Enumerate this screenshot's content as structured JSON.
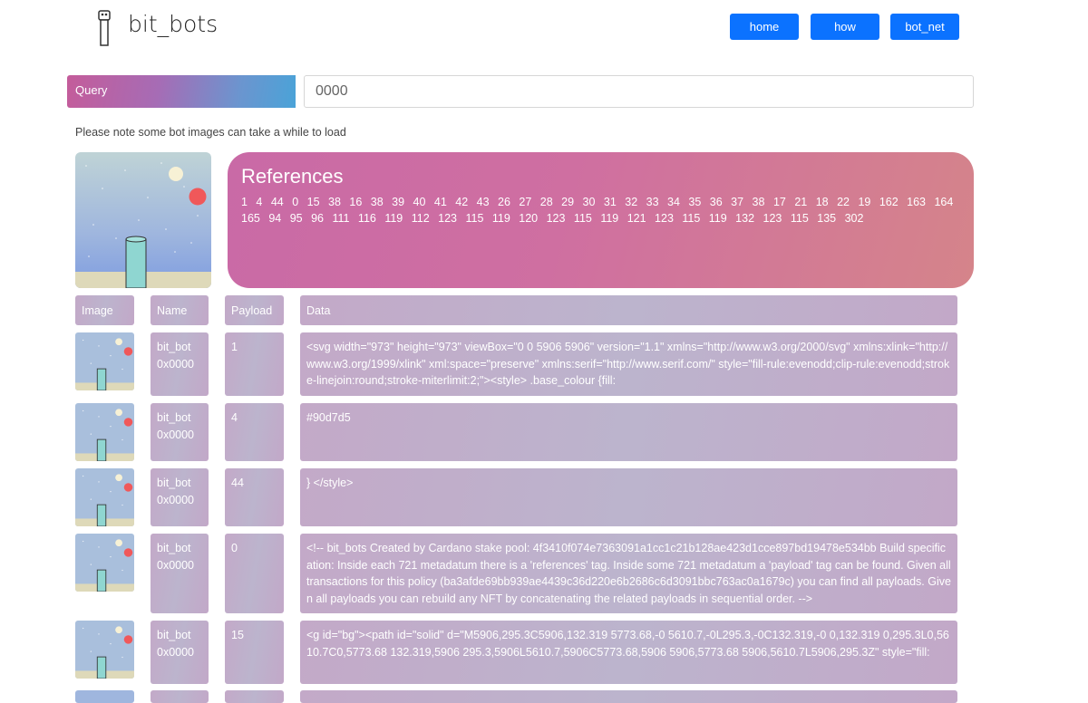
{
  "brand": "bit_bots",
  "nav": {
    "home": "home",
    "how": "how",
    "bot_net": "bot_net"
  },
  "query": {
    "label": "Query",
    "value": "0000"
  },
  "note": "Please note some bot images can take a while to load",
  "references": {
    "title": "References",
    "numbers": "1 4 44 0 15 38 16 38 39 40 41 42 43 26 27 28 29 30 31 32 33 34 35 36 37 38 17 21 18 22 19 162 163 164 165 94 95 96 111 116 119 112 123 115 119 120 123 115 119 121 123 115 119 132 123 115 135 302"
  },
  "table": {
    "headers": [
      "Image",
      "Name",
      "Payload",
      "Data"
    ],
    "rows": [
      {
        "name": "bit_bot 0x0000",
        "payload": "1",
        "data": "<svg width=\"973\" height=\"973\" viewBox=\"0 0 5906 5906\" version=\"1.1\" xmlns=\"http://www.w3.org/2000/svg\" xmlns:xlink=\"http://www.w3.org/1999/xlink\" xml:space=\"preserve\" xmlns:serif=\"http://www.serif.com/\" style=\"fill-rule:evenodd;clip-rule:evenodd;stroke-linejoin:round;stroke-miterlimit:2;\"><style> .base_colour {fill:"
      },
      {
        "name": "bit_bot 0x0000",
        "payload": "4",
        "data": "#90d7d5"
      },
      {
        "name": "bit_bot 0x0000",
        "payload": "44",
        "data": "} </style>"
      },
      {
        "name": "bit_bot 0x0000",
        "payload": "0",
        "data": "<!-- bit_bots Created by Cardano stake pool: 4f3410f074e7363091a1cc1c21b128ae423d1cce897bd19478e534bb Build specification: Inside each 721 metadatum there is a 'references' tag. Inside some 721 metadatum a 'payload' tag can be found. Given all transactions for this policy (ba3afde69bb939ae4439c36d220e6b2686c6d3091bbc763ac0a1679c) you can find all payloads. Given all payloads you can rebuild any NFT by concatenating the related payloads in sequential order. -->"
      },
      {
        "name": "bit_bot 0x0000",
        "payload": "15",
        "data": "<g id=\"bg\"><path id=\"solid\" d=\"M5906,295.3C5906,132.319 5773.68,-0 5610.7,-0L295.3,-0C132.319,-0 0,132.319 0,295.3L0,5610.7C0,5773.68 132.319,5906 295.3,5906L5610.7,5906C5773.68,5906 5906,5773.68 5906,5610.7L5906,295.3Z\" style=\"fill:"
      }
    ]
  }
}
